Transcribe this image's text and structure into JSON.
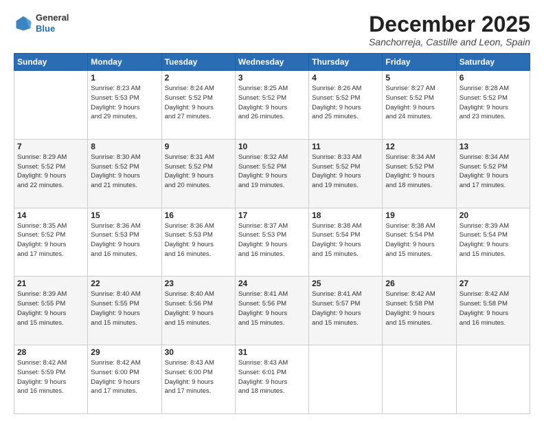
{
  "logo": {
    "line1": "General",
    "line2": "Blue"
  },
  "title": "December 2025",
  "subtitle": "Sanchorreja, Castille and Leon, Spain",
  "days_of_week": [
    "Sunday",
    "Monday",
    "Tuesday",
    "Wednesday",
    "Thursday",
    "Friday",
    "Saturday"
  ],
  "weeks": [
    [
      {
        "day": "",
        "info": ""
      },
      {
        "day": "1",
        "info": "Sunrise: 8:23 AM\nSunset: 5:53 PM\nDaylight: 9 hours\nand 29 minutes."
      },
      {
        "day": "2",
        "info": "Sunrise: 8:24 AM\nSunset: 5:52 PM\nDaylight: 9 hours\nand 27 minutes."
      },
      {
        "day": "3",
        "info": "Sunrise: 8:25 AM\nSunset: 5:52 PM\nDaylight: 9 hours\nand 26 minutes."
      },
      {
        "day": "4",
        "info": "Sunrise: 8:26 AM\nSunset: 5:52 PM\nDaylight: 9 hours\nand 25 minutes."
      },
      {
        "day": "5",
        "info": "Sunrise: 8:27 AM\nSunset: 5:52 PM\nDaylight: 9 hours\nand 24 minutes."
      },
      {
        "day": "6",
        "info": "Sunrise: 8:28 AM\nSunset: 5:52 PM\nDaylight: 9 hours\nand 23 minutes."
      }
    ],
    [
      {
        "day": "7",
        "info": "Sunrise: 8:29 AM\nSunset: 5:52 PM\nDaylight: 9 hours\nand 22 minutes."
      },
      {
        "day": "8",
        "info": "Sunrise: 8:30 AM\nSunset: 5:52 PM\nDaylight: 9 hours\nand 21 minutes."
      },
      {
        "day": "9",
        "info": "Sunrise: 8:31 AM\nSunset: 5:52 PM\nDaylight: 9 hours\nand 20 minutes."
      },
      {
        "day": "10",
        "info": "Sunrise: 8:32 AM\nSunset: 5:52 PM\nDaylight: 9 hours\nand 19 minutes."
      },
      {
        "day": "11",
        "info": "Sunrise: 8:33 AM\nSunset: 5:52 PM\nDaylight: 9 hours\nand 19 minutes."
      },
      {
        "day": "12",
        "info": "Sunrise: 8:34 AM\nSunset: 5:52 PM\nDaylight: 9 hours\nand 18 minutes."
      },
      {
        "day": "13",
        "info": "Sunrise: 8:34 AM\nSunset: 5:52 PM\nDaylight: 9 hours\nand 17 minutes."
      }
    ],
    [
      {
        "day": "14",
        "info": "Sunrise: 8:35 AM\nSunset: 5:52 PM\nDaylight: 9 hours\nand 17 minutes."
      },
      {
        "day": "15",
        "info": "Sunrise: 8:36 AM\nSunset: 5:53 PM\nDaylight: 9 hours\nand 16 minutes."
      },
      {
        "day": "16",
        "info": "Sunrise: 8:36 AM\nSunset: 5:53 PM\nDaylight: 9 hours\nand 16 minutes."
      },
      {
        "day": "17",
        "info": "Sunrise: 8:37 AM\nSunset: 5:53 PM\nDaylight: 9 hours\nand 16 minutes."
      },
      {
        "day": "18",
        "info": "Sunrise: 8:38 AM\nSunset: 5:54 PM\nDaylight: 9 hours\nand 15 minutes."
      },
      {
        "day": "19",
        "info": "Sunrise: 8:38 AM\nSunset: 5:54 PM\nDaylight: 9 hours\nand 15 minutes."
      },
      {
        "day": "20",
        "info": "Sunrise: 8:39 AM\nSunset: 5:54 PM\nDaylight: 9 hours\nand 15 minutes."
      }
    ],
    [
      {
        "day": "21",
        "info": "Sunrise: 8:39 AM\nSunset: 5:55 PM\nDaylight: 9 hours\nand 15 minutes."
      },
      {
        "day": "22",
        "info": "Sunrise: 8:40 AM\nSunset: 5:55 PM\nDaylight: 9 hours\nand 15 minutes."
      },
      {
        "day": "23",
        "info": "Sunrise: 8:40 AM\nSunset: 5:56 PM\nDaylight: 9 hours\nand 15 minutes."
      },
      {
        "day": "24",
        "info": "Sunrise: 8:41 AM\nSunset: 5:56 PM\nDaylight: 9 hours\nand 15 minutes."
      },
      {
        "day": "25",
        "info": "Sunrise: 8:41 AM\nSunset: 5:57 PM\nDaylight: 9 hours\nand 15 minutes."
      },
      {
        "day": "26",
        "info": "Sunrise: 8:42 AM\nSunset: 5:58 PM\nDaylight: 9 hours\nand 15 minutes."
      },
      {
        "day": "27",
        "info": "Sunrise: 8:42 AM\nSunset: 5:58 PM\nDaylight: 9 hours\nand 16 minutes."
      }
    ],
    [
      {
        "day": "28",
        "info": "Sunrise: 8:42 AM\nSunset: 5:59 PM\nDaylight: 9 hours\nand 16 minutes."
      },
      {
        "day": "29",
        "info": "Sunrise: 8:42 AM\nSunset: 6:00 PM\nDaylight: 9 hours\nand 17 minutes."
      },
      {
        "day": "30",
        "info": "Sunrise: 8:43 AM\nSunset: 6:00 PM\nDaylight: 9 hours\nand 17 minutes."
      },
      {
        "day": "31",
        "info": "Sunrise: 8:43 AM\nSunset: 6:01 PM\nDaylight: 9 hours\nand 18 minutes."
      },
      {
        "day": "",
        "info": ""
      },
      {
        "day": "",
        "info": ""
      },
      {
        "day": "",
        "info": ""
      }
    ]
  ]
}
